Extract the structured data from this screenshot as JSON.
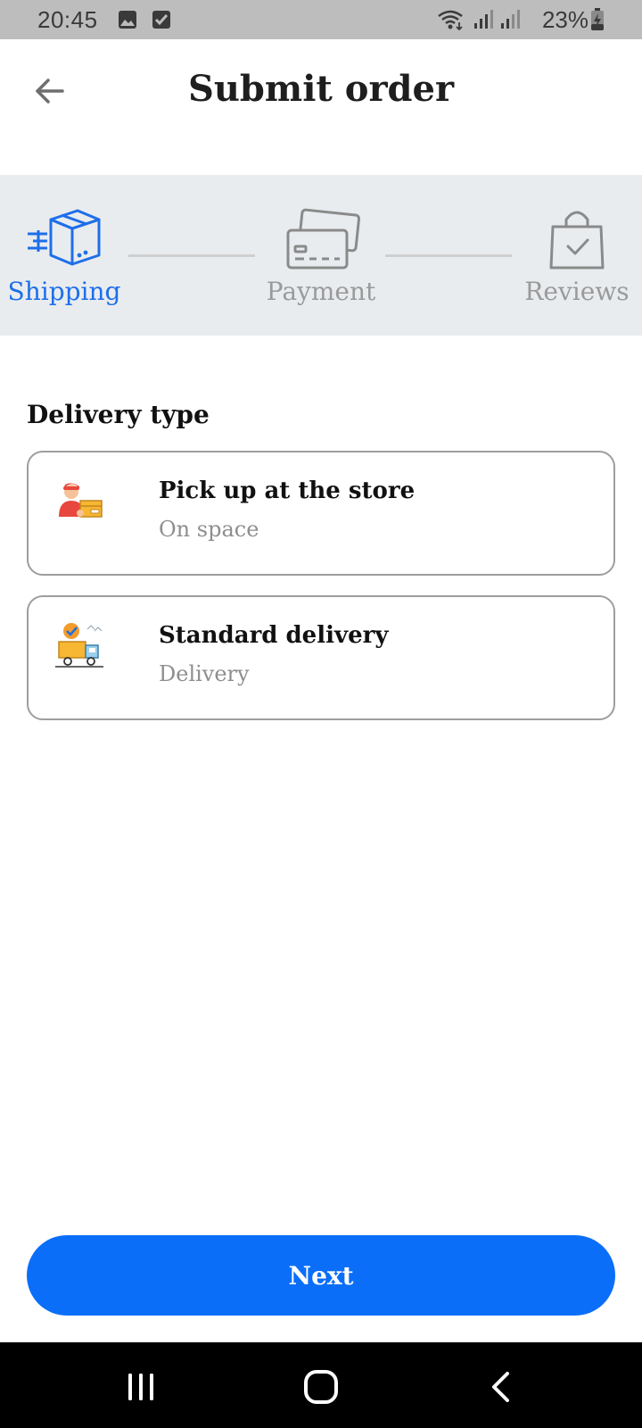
{
  "status_bar": {
    "time": "20:45",
    "battery": "23%",
    "icons": [
      "gallery-notification-icon",
      "task-notification-icon",
      "wifi-icon",
      "signal-icon",
      "signal-icon",
      "battery-charging-icon"
    ]
  },
  "header": {
    "title": "Submit order",
    "back_icon": "arrow-left-icon"
  },
  "stepper": {
    "steps": [
      {
        "label": "Shipping",
        "icon": "shipping-box-icon",
        "state": "active"
      },
      {
        "label": "Payment",
        "icon": "credit-cards-icon",
        "state": "inactive"
      },
      {
        "label": "Reviews",
        "icon": "shopping-bag-check-icon",
        "state": "inactive"
      }
    ]
  },
  "delivery": {
    "section_title": "Delivery type",
    "options": [
      {
        "title": "Pick up at the store",
        "subtitle": "On space",
        "icon": "courier-with-package-icon"
      },
      {
        "title": "Standard delivery",
        "subtitle": "Delivery",
        "icon": "delivery-truck-icon"
      }
    ]
  },
  "actions": {
    "next_label": "Next"
  },
  "nav_bar": {
    "buttons": [
      "recent-apps-icon",
      "home-icon",
      "back-icon"
    ]
  },
  "colors": {
    "accent": "#0b6ef8",
    "active_step": "#1e6fe8",
    "inactive_step": "#9a9a9a",
    "stepper_background": "#e9ecef",
    "status_bar": "#bdbdbd"
  }
}
